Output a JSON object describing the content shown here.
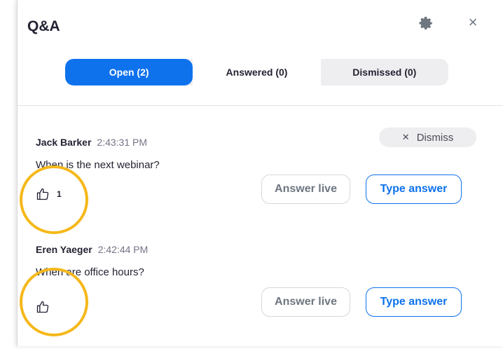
{
  "panel": {
    "title": "Q&A",
    "settings_icon": "gear-icon",
    "close_label": "×"
  },
  "tabs": [
    {
      "label": "Open (2)",
      "active": true
    },
    {
      "label": "Answered (0)",
      "active": false
    },
    {
      "label": "Dismissed (0)",
      "active": false
    }
  ],
  "questions": [
    {
      "asker": "Jack Barker",
      "time": "2:43:31 PM",
      "text": "When is the next webinar?",
      "likes": "1",
      "dismiss_label": "Dismiss",
      "answer_live_label": "Answer live",
      "type_answer_label": "Type answer"
    },
    {
      "asker": "Eren Yaeger",
      "time": "2:42:44 PM",
      "text": "When are office hours?",
      "likes": "",
      "answer_live_label": "Answer live",
      "type_answer_label": "Type answer"
    }
  ],
  "colors": {
    "accent": "#0e72ed",
    "highlight": "#f5b81a"
  }
}
